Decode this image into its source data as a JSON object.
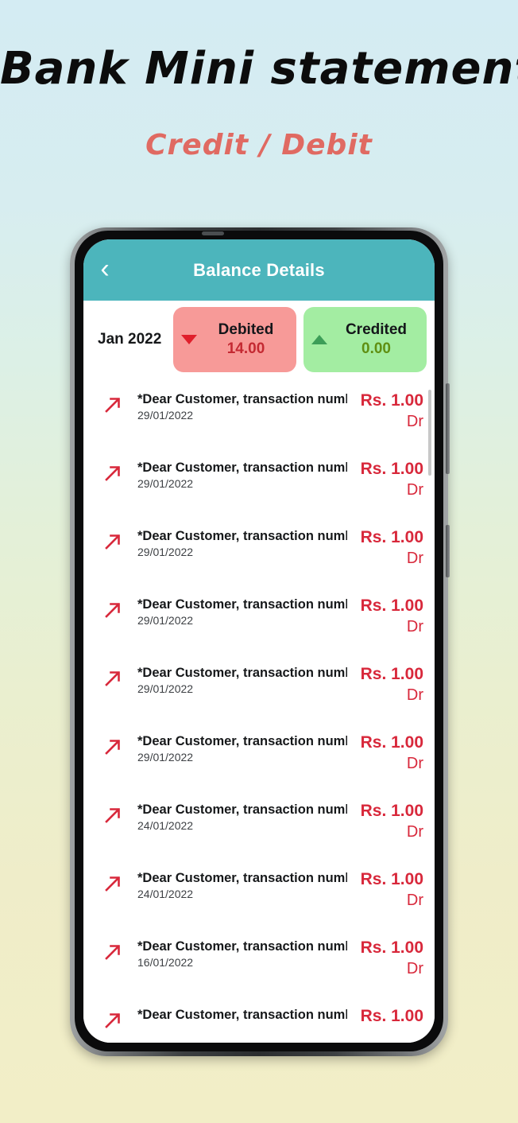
{
  "promo": {
    "title": "Bank Mini statement",
    "subtitle": "Credit / Debit",
    "title_color": "#0c0c0c",
    "subtitle_color": "#e06a62",
    "background_top_color": "#d4ecf3",
    "background_bottom_color": "#f2eec7"
  },
  "app": {
    "app_bar": {
      "back_icon": "chevron-left-icon",
      "back_glyph": "‹",
      "title": "Balance Details",
      "background_color": "#4cb5bc",
      "title_color": "#ffffff"
    },
    "summary": {
      "period": "Jan 2022",
      "debited": {
        "label": "Debited",
        "value": "14.00",
        "icon": "triangle-down-icon",
        "background_color": "#f79a98",
        "value_color": "#c42932"
      },
      "credited": {
        "label": "Credited",
        "value": "0.00",
        "icon": "triangle-up-icon",
        "background_color": "#a3eda2",
        "value_color": "#5f8f12"
      }
    },
    "transactions": [
      {
        "icon": "arrow-up-right-icon",
        "description": "*Dear Customer, transaction number…",
        "date": "29/01/2022",
        "amount": "Rs. 1.00",
        "type": "Dr"
      },
      {
        "icon": "arrow-up-right-icon",
        "description": "*Dear Customer, transaction number…",
        "date": "29/01/2022",
        "amount": "Rs. 1.00",
        "type": "Dr"
      },
      {
        "icon": "arrow-up-right-icon",
        "description": "*Dear Customer, transaction number…",
        "date": "29/01/2022",
        "amount": "Rs. 1.00",
        "type": "Dr"
      },
      {
        "icon": "arrow-up-right-icon",
        "description": "*Dear Customer, transaction number…",
        "date": "29/01/2022",
        "amount": "Rs. 1.00",
        "type": "Dr"
      },
      {
        "icon": "arrow-up-right-icon",
        "description": "*Dear Customer, transaction number…",
        "date": "29/01/2022",
        "amount": "Rs. 1.00",
        "type": "Dr"
      },
      {
        "icon": "arrow-up-right-icon",
        "description": "*Dear Customer, transaction number…",
        "date": "29/01/2022",
        "amount": "Rs. 1.00",
        "type": "Dr"
      },
      {
        "icon": "arrow-up-right-icon",
        "description": "*Dear Customer, transaction number…",
        "date": "24/01/2022",
        "amount": "Rs. 1.00",
        "type": "Dr"
      },
      {
        "icon": "arrow-up-right-icon",
        "description": "*Dear Customer, transaction number…",
        "date": "24/01/2022",
        "amount": "Rs. 1.00",
        "type": "Dr"
      },
      {
        "icon": "arrow-up-right-icon",
        "description": "*Dear Customer, transaction number…",
        "date": "16/01/2022",
        "amount": "Rs. 1.00",
        "type": "Dr"
      },
      {
        "icon": "arrow-up-right-icon",
        "description": "*Dear Customer, transaction number…",
        "date": "",
        "amount": "Rs. 1.00",
        "type": ""
      }
    ],
    "transaction_amount_color": "#d8283b",
    "transaction_icon_color": "#d8283b"
  }
}
